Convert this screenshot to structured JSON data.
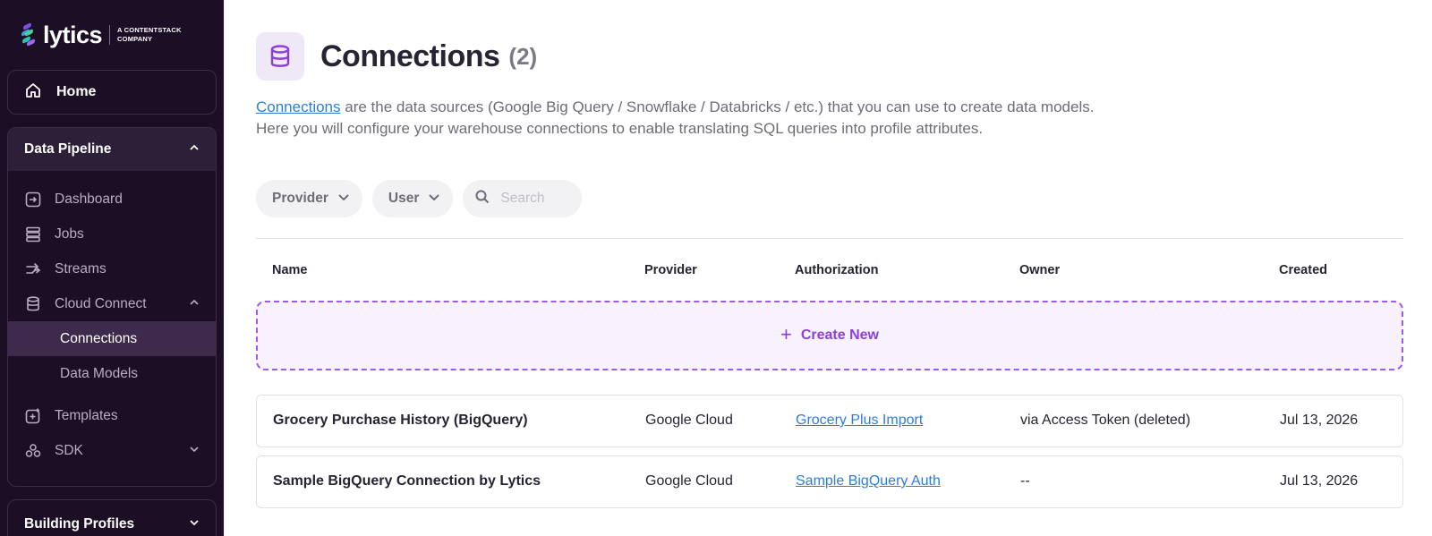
{
  "app": {
    "logo_word": "lytics",
    "logo_sub_line1": "A CONTENTSTACK",
    "logo_sub_line2": "COMPANY"
  },
  "sidebar": {
    "home": "Home",
    "data_pipeline": {
      "label": "Data Pipeline",
      "items": [
        {
          "label": "Dashboard",
          "icon": "dashboard-icon"
        },
        {
          "label": "Jobs",
          "icon": "jobs-icon"
        },
        {
          "label": "Streams",
          "icon": "streams-icon"
        },
        {
          "label": "Cloud Connect",
          "icon": "database-icon"
        }
      ],
      "cloud_connect_sub": [
        "Connections",
        "Data Models"
      ],
      "more_items": [
        {
          "label": "Templates",
          "icon": "templates-icon"
        },
        {
          "label": "SDK",
          "icon": "sdk-icon"
        }
      ]
    },
    "building_profiles": "Building Profiles"
  },
  "page": {
    "title": "Connections",
    "count": "(2)",
    "desc_link": "Connections",
    "desc_rest": " are the data sources (Google Big Query / Snowflake / Databricks / etc.) that you can use to create data models.",
    "desc_line2": "Here you will configure your warehouse connections to enable translating SQL queries into profile attributes."
  },
  "filters": {
    "provider": "Provider",
    "user": "User",
    "search_placeholder": "Search"
  },
  "table": {
    "headers": [
      "Name",
      "Provider",
      "Authorization",
      "Owner",
      "Created"
    ],
    "create_new": "Create New",
    "rows": [
      {
        "name": "Grocery Purchase History (BigQuery)",
        "provider": "Google Cloud",
        "authorization": "Grocery Plus Import",
        "owner": "via Access Token (deleted)",
        "created": "Jul 13, 2026"
      },
      {
        "name": "Sample BigQuery Connection by Lytics",
        "provider": "Google Cloud",
        "authorization": "Sample BigQuery Auth",
        "owner": "--",
        "created": "Jul 13, 2026"
      }
    ]
  },
  "colors": {
    "sidebar_bg": "#1c0f25",
    "accent_purple": "#8a3fe0",
    "link_blue": "#2e7dd8"
  }
}
